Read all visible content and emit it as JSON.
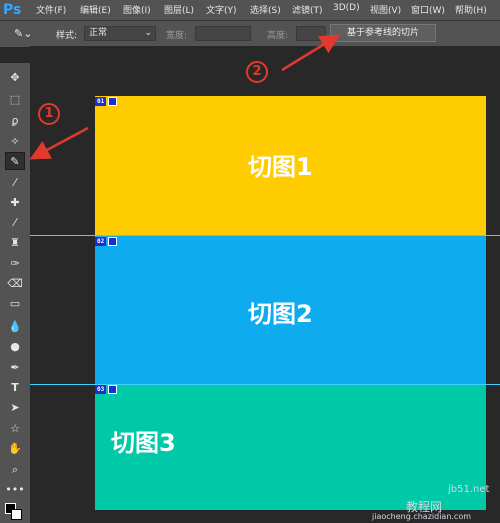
{
  "app": {
    "logo": "Ps"
  },
  "menu": [
    "文件(F)",
    "编辑(E)",
    "图像(I)",
    "图层(L)",
    "文字(Y)",
    "选择(S)",
    "滤镜(T)",
    "3D(D)",
    "视图(V)",
    "窗口(W)",
    "帮助(H)"
  ],
  "options": {
    "style_label": "样式:",
    "style_value": "正常",
    "width_label": "宽度:",
    "height_label": "高度:",
    "slice_from_guides": "基于参考线的切片"
  },
  "slices": [
    {
      "number": "01",
      "text": "切图1",
      "color": "#ffcc00"
    },
    {
      "number": "02",
      "text": "切图2",
      "color": "#0eabee"
    },
    {
      "number": "03",
      "text": "切图3",
      "color": "#00c9a7"
    }
  ],
  "callouts": [
    "1",
    "2"
  ],
  "watermark": {
    "site": "jb51.net",
    "brand": "教程网",
    "url": "jiaocheng.chazidian.com"
  },
  "colors": {
    "guide": "#3fd1ff",
    "arrow": "#e03a2c",
    "ui_bg": "#535353",
    "canvas_bg": "#282828"
  }
}
